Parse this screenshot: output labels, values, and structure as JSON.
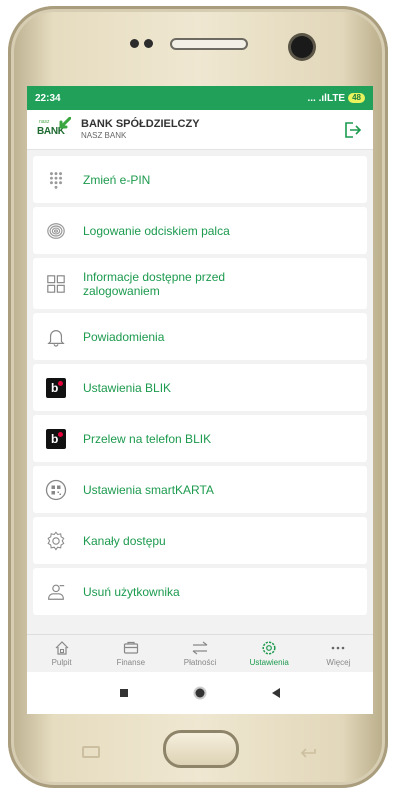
{
  "status": {
    "time": "22:34",
    "signal": "... .ılLTE",
    "battery": "48"
  },
  "header": {
    "brand_small": "nasz",
    "brand_big": "BANK",
    "bank_name": "BANK SPÓŁDZIELCZY",
    "bank_sub": "NASZ BANK"
  },
  "menu": [
    {
      "label": "Zmień e-PIN",
      "icon": "keypad-icon"
    },
    {
      "label": "Logowanie odciskiem palca",
      "icon": "fingerprint-icon"
    },
    {
      "label": "Informacje dostępne przed zalogowaniem",
      "icon": "grid-icon"
    },
    {
      "label": "Powiadomienia",
      "icon": "bell-icon"
    },
    {
      "label": "Ustawienia BLIK",
      "icon": "blik-icon"
    },
    {
      "label": "Przelew na telefon BLIK",
      "icon": "blik-icon"
    },
    {
      "label": "Ustawienia smartKARTA",
      "icon": "smartcard-icon"
    },
    {
      "label": "Kanały dostępu",
      "icon": "gear-icon"
    },
    {
      "label": "Usuń użytkownika",
      "icon": "user-remove-icon"
    }
  ],
  "tabs": [
    {
      "label": "Pulpit",
      "icon": "home-icon"
    },
    {
      "label": "Finanse",
      "icon": "wallet-icon"
    },
    {
      "label": "Płatności",
      "icon": "transfer-icon"
    },
    {
      "label": "Ustawienia",
      "icon": "gear-icon",
      "active": true
    },
    {
      "label": "Więcej",
      "icon": "more-icon"
    }
  ],
  "colors": {
    "accent": "#1c9a4e",
    "statusbar": "#21a05a"
  }
}
